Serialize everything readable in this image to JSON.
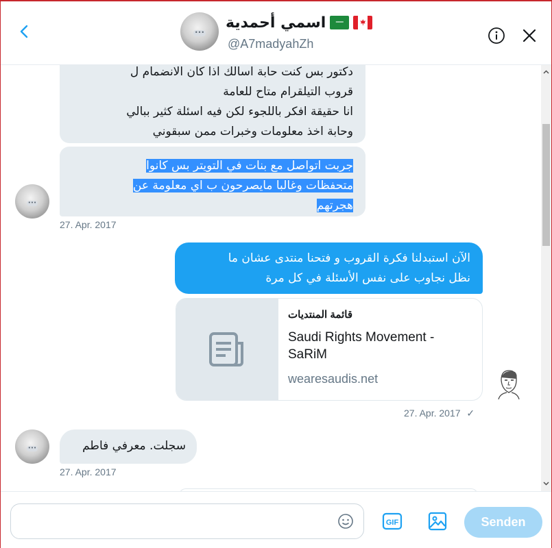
{
  "header": {
    "display_name": "اسمي أحمدية",
    "screen_name": "@A7madyahZh",
    "flags": [
      "saudi-flag",
      "canada-flag"
    ],
    "avatar_badge": "•••"
  },
  "messages": {
    "m1": {
      "lines": [
        "دكتور بس كنت حابة اسالك اذا كان الانضمام ل",
        "قروب التيلقرام متاح للعامة",
        "انا حقيقة افكر باللجوء لكن فيه اسئلة كثير ببالي",
        "وحابة اخذ معلومات وخبرات ممن سبقوني"
      ]
    },
    "m2": {
      "lines": [
        "جربت اتواصل مع بنات في التويتر بس كانوا",
        "متحفظات وغالبا مايصرحون ب اي معلومة عن",
        "هجرتهم"
      ],
      "time": "27. Apr. 2017"
    },
    "m3": {
      "lines": [
        "الآن استبدلنا فكرة القروب و فتحنا منتدى عشان ما",
        "نظل نجاوب على نفس الأسئلة في كل مرة"
      ],
      "card": {
        "title": "قائمة المنتديات",
        "description": "Saudi Rights Movement - SaRiM",
        "domain": "wearesaudis.net"
      },
      "time": "27. Apr. 2017",
      "status": "✓"
    },
    "m4": {
      "text": "سجلت. معرفي فاطم",
      "time": "27. Apr. 2017"
    }
  },
  "composer": {
    "placeholder": "",
    "gif_label": "GIF",
    "send_label": "Senden"
  },
  "colors": {
    "accent": "#1da1f2",
    "incoming_bubble": "#e6ecf0",
    "selection": "#3390ff",
    "send_disabled": "#a6d8f7"
  }
}
